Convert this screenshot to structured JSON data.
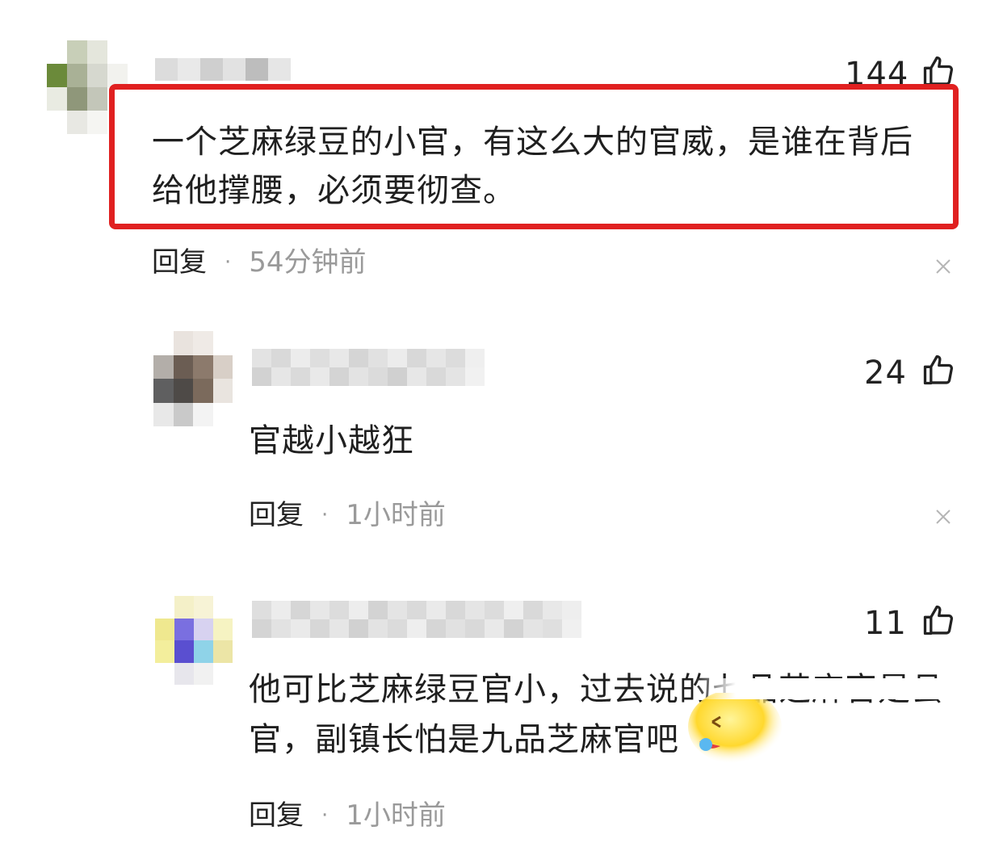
{
  "comments": [
    {
      "likes": "144",
      "text_lines": [
        "一个芝麻绿豆的小官，有这么大的官威，是谁在背后",
        "给他撑腰，必须要彻查。"
      ],
      "reply_label": "回复",
      "separator": "·",
      "time": "54分钟前"
    },
    {
      "likes": "24",
      "text_lines": [
        "官越小越狂"
      ],
      "reply_label": "回复",
      "separator": "·",
      "time": "1小时前"
    },
    {
      "likes": "11",
      "text_lines": [
        "他可比芝麻绿豆官小，过去说的七品芝麻官是县",
        "官，副镇长怕是九品芝麻官吧"
      ],
      "reply_label": "回复",
      "separator": "·",
      "time": "1小时前"
    }
  ],
  "colors": {
    "highlight_border": "#e02020",
    "meta_gray": "#9a9a9a",
    "text": "#1f1f1f"
  },
  "icons": {
    "like": "thumbs-up-icon",
    "close": "close-icon",
    "emoji": "laughing-emoji-icon"
  }
}
